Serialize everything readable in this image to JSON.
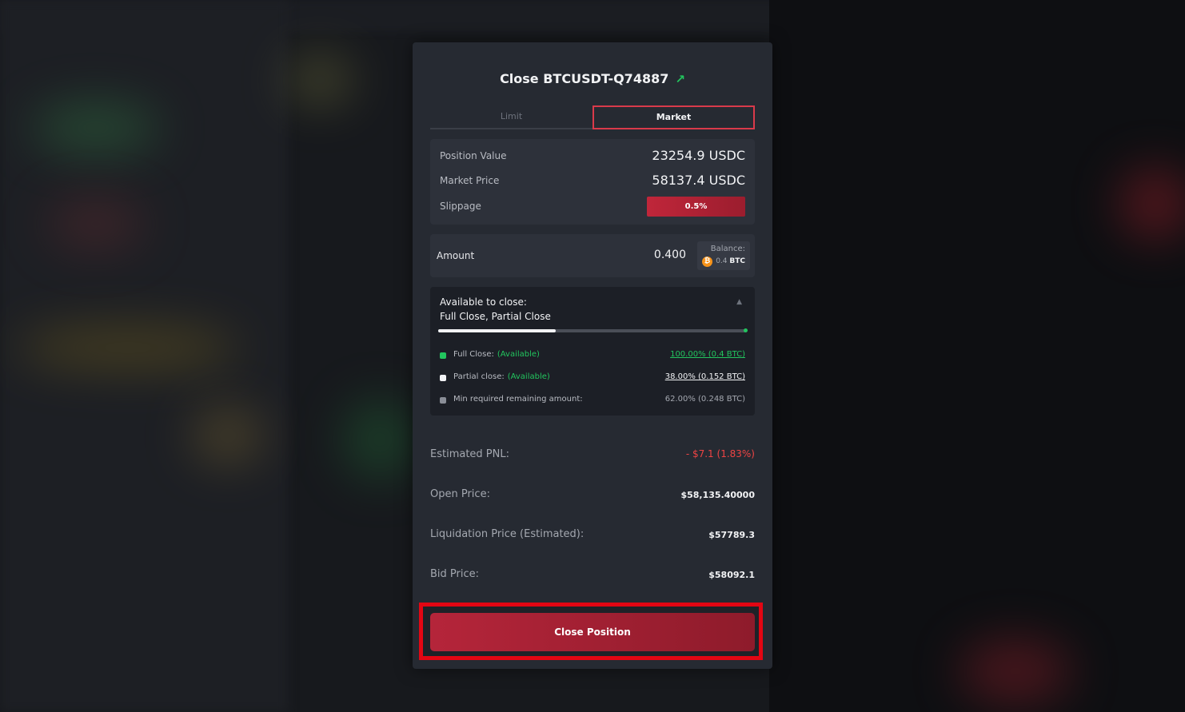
{
  "modal": {
    "title": "Close BTCUSDT-Q74887",
    "tabs": [
      {
        "label": "Limit"
      },
      {
        "label": "Market"
      }
    ],
    "info": {
      "position_value_label": "Position Value",
      "position_value": "23254.9 USDC",
      "market_price_label": "Market Price",
      "market_price": "58137.4 USDC",
      "slippage_label": "Slippage",
      "slippage": "0.5%"
    },
    "amount": {
      "label": "Amount",
      "value": "0.400",
      "balance_label": "Balance:",
      "balance_amount": "0.4",
      "balance_unit": "BTC"
    },
    "available": {
      "title": "Available to close:",
      "subtitle": "Full Close, Partial Close",
      "progress_fraction": 0.38,
      "rows": [
        {
          "label": "Full Close:",
          "status": "(Available)",
          "value": "100.00% (0.4 BTC)"
        },
        {
          "label": "Partial close:",
          "status": "(Available)",
          "value": "38.00% (0.152 BTC)"
        },
        {
          "label": "Min required remaining amount:",
          "status": "",
          "value": "62.00% (0.248 BTC)"
        }
      ]
    },
    "stats": {
      "pnl_label": "Estimated PNL:",
      "pnl_value": "- $7.1 (1.83%)",
      "open_price_label": "Open Price:",
      "open_price": "$58,135.40000",
      "liq_price_label": "Liquidation Price (Estimated):",
      "liq_price": "$57789.3",
      "bid_price_label": "Bid Price:",
      "bid_price": "$58092.1"
    },
    "close_button_label": "Close Position"
  },
  "colors": {
    "accent_red": "#c0263a",
    "positive_green": "#22c55e",
    "negative_red": "#ef4444",
    "highlight_outline": "#e30613"
  }
}
